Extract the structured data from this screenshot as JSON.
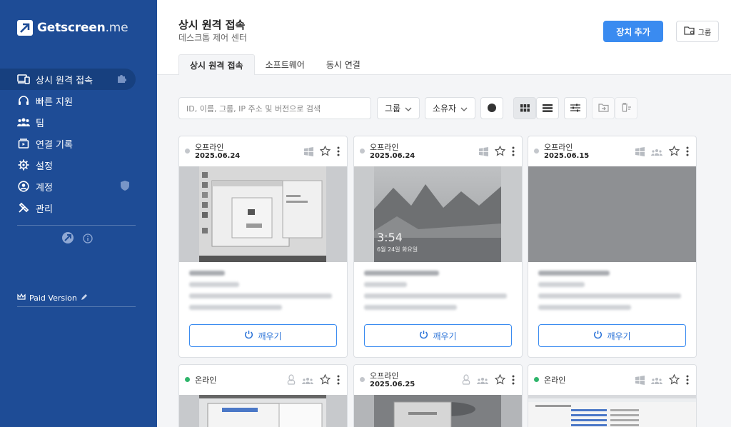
{
  "brand": {
    "name": "Getscreen",
    "suffix": ".me"
  },
  "sidebar": {
    "items": [
      {
        "label": "상시 원격 접속",
        "icon": "devices-icon",
        "active": true
      },
      {
        "label": "빠른 지원",
        "icon": "headset-icon"
      },
      {
        "label": "팀",
        "icon": "team-icon"
      },
      {
        "label": "연결 기록",
        "icon": "history-icon"
      },
      {
        "label": "설정",
        "icon": "gear-icon"
      },
      {
        "label": "계정",
        "icon": "user-circle-icon"
      },
      {
        "label": "관리",
        "icon": "tools-icon"
      }
    ],
    "paid_label": "Paid Version"
  },
  "header": {
    "title": "상시 원격 접속",
    "subtitle": "데스크톱 제어 센터",
    "add_device_label": "장치 추가",
    "group_label": "그룹"
  },
  "tabs": [
    {
      "label": "상시 원격 접속",
      "active": true
    },
    {
      "label": "소프트웨어"
    },
    {
      "label": "동시 연결"
    }
  ],
  "toolbar": {
    "search_placeholder": "ID, 이름, 그룹, IP 주소 및 버전으로 검색",
    "group_filter": "그룹",
    "owner_filter": "소유자"
  },
  "cards": [
    {
      "status": "오프라인",
      "date": "2025.06.24",
      "os": "windows-icon",
      "wake_label": "깨우기",
      "online": false
    },
    {
      "status": "오프라인",
      "date": "2025.06.24",
      "os": "windows-icon",
      "wake_label": "깨우기",
      "online": false,
      "lock_time": "3:54",
      "lock_date": "6월 24일 화요일"
    },
    {
      "status": "오프라인",
      "date": "2025.06.15",
      "os": "windows-icon",
      "wake_label": "깨우기",
      "online": false
    },
    {
      "status": "온라인",
      "date": "",
      "os": "linux-icon",
      "online": true
    },
    {
      "status": "오프라인",
      "date": "2025.06.25",
      "os": "linux-icon",
      "online": false
    },
    {
      "status": "온라인",
      "date": "",
      "os": "windows-icon",
      "online": true
    }
  ],
  "colors": {
    "sidebar": "#1e4c96",
    "accent": "#3a8bf0",
    "online": "#2fb56b",
    "offline": "#c4c7cc"
  }
}
